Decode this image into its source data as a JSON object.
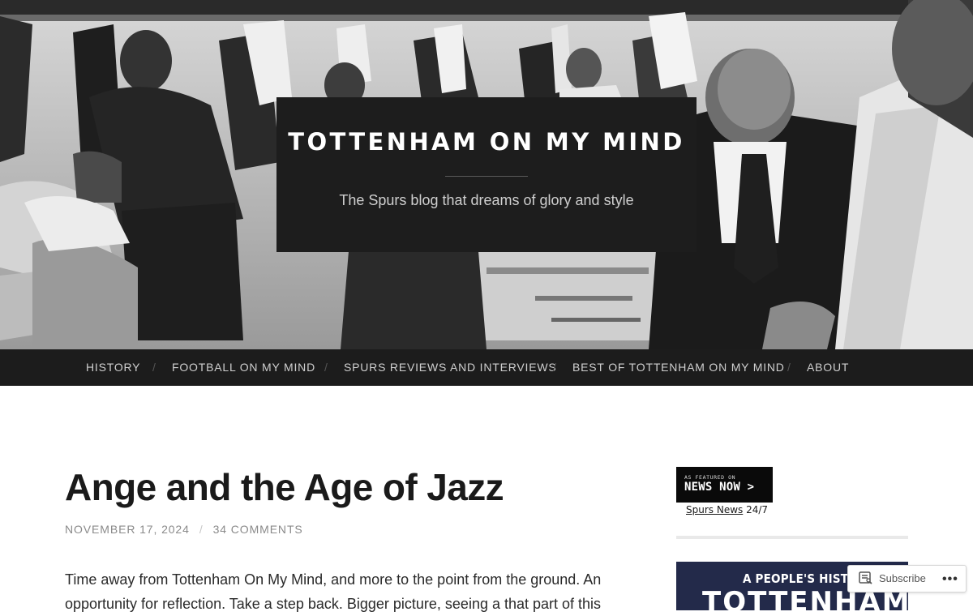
{
  "header": {
    "site_title": "TOTTENHAM ON MY MIND",
    "tagline": "The Spurs blog that dreams of glory and style"
  },
  "nav": {
    "items": [
      {
        "label": "HISTORY"
      },
      {
        "label": "FOOTBALL ON MY MIND"
      },
      {
        "label": "SPURS REVIEWS AND INTERVIEWS"
      },
      {
        "label": "BEST OF TOTTENHAM ON MY MIND"
      },
      {
        "label": "ABOUT"
      }
    ],
    "separator": "/"
  },
  "post": {
    "title": "Ange and the Age of Jazz",
    "date": "NOVEMBER 17, 2024",
    "meta_separator": "/",
    "comments": "34 COMMENTS",
    "body_line1": "Time away from Tottenham On My Mind, and more to the point from the ground. An",
    "body_line2": "opportunity for reflection. Take a step back. Bigger picture, seeing a that part of this"
  },
  "sidebar": {
    "badge_small": "AS FEATURED ON",
    "badge_big": "NEWS NOW >",
    "caption_link": "Spurs News",
    "caption_rest": " 24/7",
    "book_line1": "A PEOPLE'S HISTORY OF",
    "book_line2": "TOTTENHAM"
  },
  "subscribe": {
    "label": "Subscribe",
    "more": "•••"
  }
}
